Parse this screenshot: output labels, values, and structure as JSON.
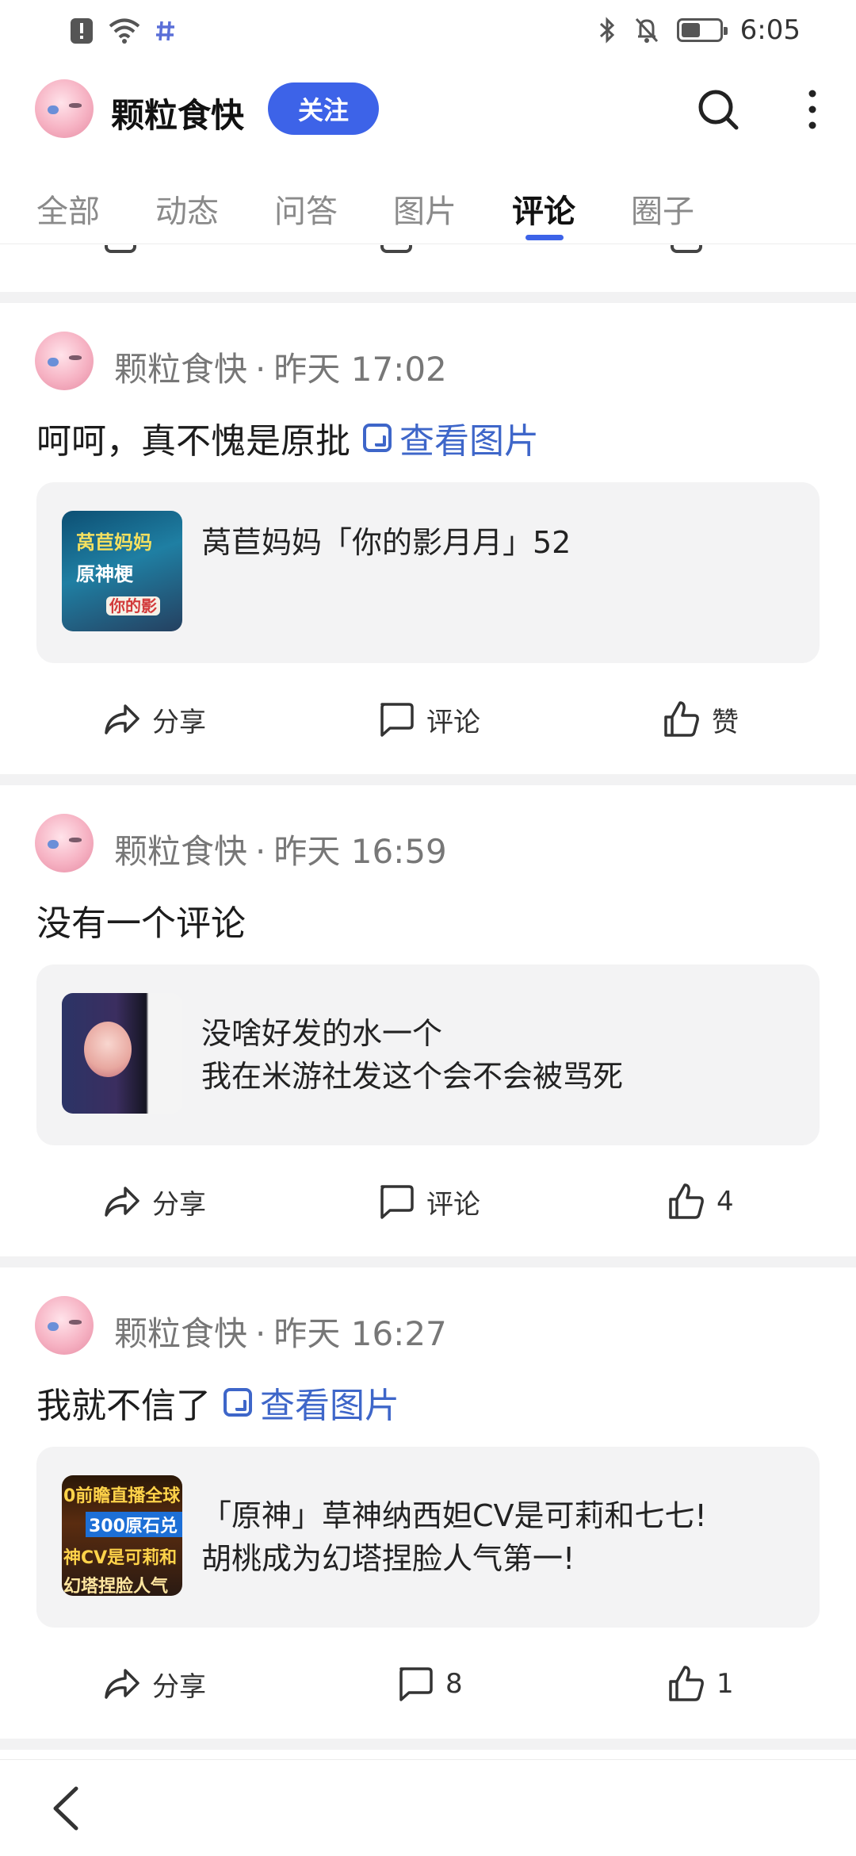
{
  "status_bar": {
    "time": "6:05",
    "battery_level": 0.5,
    "icons": [
      "alert-icon",
      "wifi-icon",
      "hashtag-icon",
      "bluetooth-icon",
      "mute-bell-icon",
      "battery-icon"
    ]
  },
  "header": {
    "name": "颗粒食快",
    "follow_label": "关注"
  },
  "tabs": [
    {
      "label": "全部",
      "active": false
    },
    {
      "label": "动态",
      "active": false
    },
    {
      "label": "问答",
      "active": false
    },
    {
      "label": "图片",
      "active": false
    },
    {
      "label": "评论",
      "active": true
    },
    {
      "label": "圈子",
      "active": false
    }
  ],
  "colors": {
    "accent": "#3d63e8",
    "link": "#3e66c9",
    "card_bg": "#f3f3f4",
    "divider": "#f2f2f3"
  },
  "posts": [
    {
      "author": "颗粒食快",
      "separator": "·",
      "time": "昨天 17:02",
      "text": "呵呵，真不愧是原批",
      "view_image_label": "查看图片",
      "card": {
        "lines": [
          "莴苣妈妈「你的影月月」52"
        ],
        "thumb_text": [
          "莴苣妈妈",
          "原神梗",
          "你的影"
        ]
      },
      "actions": {
        "share": "分享",
        "comment": "评论",
        "like": "赞"
      }
    },
    {
      "author": "颗粒食快",
      "separator": "·",
      "time": "昨天 16:59",
      "text": "没有一个评论",
      "card": {
        "lines": [
          "没啥好发的水一个",
          "我在米游社发这个会不会被骂死"
        ]
      },
      "actions": {
        "share": "分享",
        "comment": "评论",
        "like": "4"
      }
    },
    {
      "author": "颗粒食快",
      "separator": "·",
      "time": "昨天 16:27",
      "text": "我就不信了",
      "view_image_label": "查看图片",
      "card": {
        "lines": [
          "「原神」草神纳西妲CV是可莉和七七!",
          "胡桃成为幻塔捏脸人气第一!"
        ],
        "thumb_text": [
          "0前瞻直播全球",
          "300原石兑",
          "神CV是可莉和",
          "幻塔捏脸人气"
        ]
      },
      "actions": {
        "share": "分享",
        "comment": "8",
        "like": "1"
      }
    }
  ]
}
